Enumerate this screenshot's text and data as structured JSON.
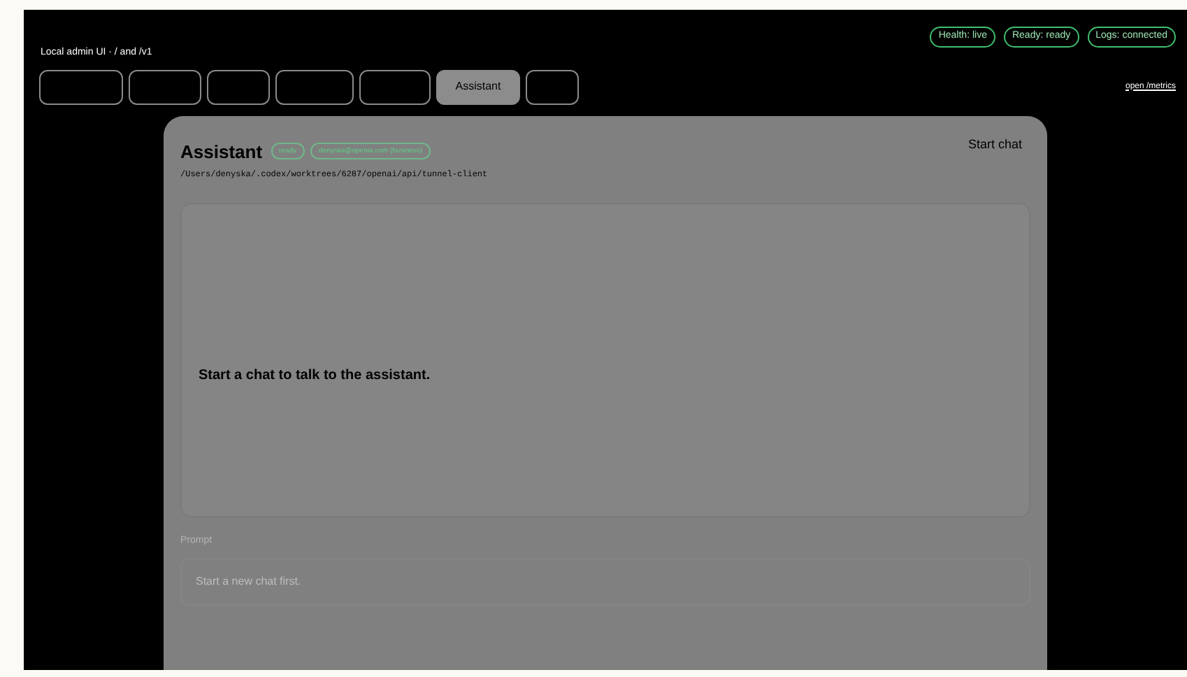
{
  "header": {
    "subtitle": "Local admin UI · / and /v1"
  },
  "status_badges": [
    "Health: live",
    "Ready: ready",
    "Logs: connected"
  ],
  "tabs": [
    {
      "selected": false
    },
    {
      "selected": false
    },
    {
      "selected": false
    },
    {
      "selected": false
    },
    {
      "selected": false
    },
    {
      "label": "Assistant",
      "selected": true
    },
    {
      "selected": false
    }
  ],
  "metrics_link": "open /metrics",
  "panel": {
    "title": "Assistant",
    "badges": [
      "ready",
      "denyska@openai.com (business)"
    ],
    "path": "/Users/denyska/.codex/worktrees/6287/openai/api/tunnel-client",
    "action": "Start chat",
    "empty_message": "Start a chat to talk to the assistant.",
    "prompt": {
      "label": "Prompt",
      "placeholder": "Start a new chat first."
    }
  }
}
